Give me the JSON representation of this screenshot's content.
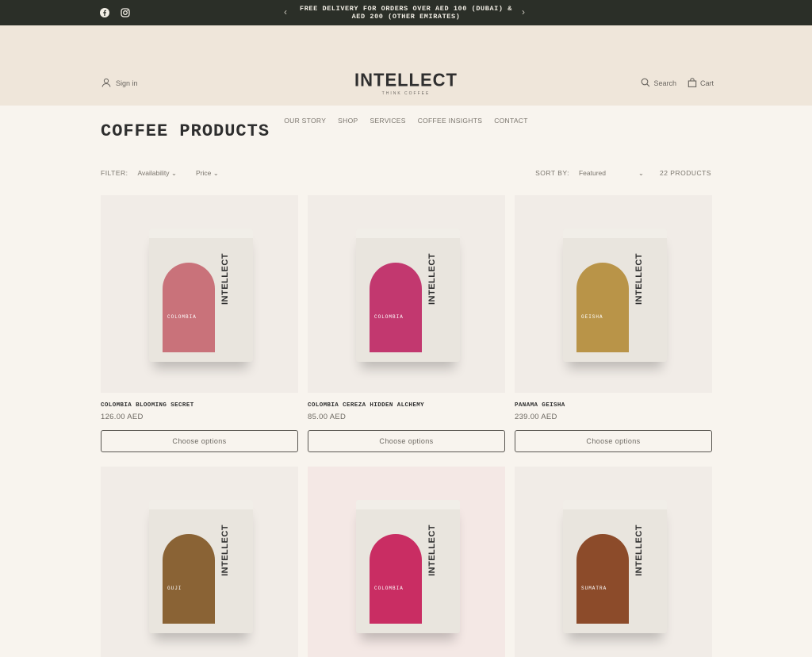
{
  "announcement": {
    "message": "FREE DELIVERY FOR ORDERS OVER AED 100 (DUBAI) & AED 200 (OTHER EMIRATES)",
    "social": [
      "facebook-icon",
      "instagram-icon"
    ]
  },
  "header": {
    "signin_label": "Sign in",
    "logo_text": "INTELLECT",
    "logo_sub": "THINK COFFEE",
    "search_label": "Search",
    "cart_label": "Cart"
  },
  "nav": {
    "items": [
      "OUR STORY",
      "SHOP",
      "SERVICES",
      "COFFEE INSIGHTS",
      "CONTACT"
    ]
  },
  "page": {
    "title": "COFFEE PRODUCTS"
  },
  "filters": {
    "label": "FILTER:",
    "availability": "Availability",
    "price": "Price",
    "sort_label": "SORT BY:",
    "sort_value": "Featured",
    "count": "22 PRODUCTS"
  },
  "products": [
    {
      "name": "COLOMBIA BLOOMING SECRET",
      "price": "126.00 AED",
      "button": "Choose options",
      "origin": "COLOMBIA",
      "brand": "INTELLECT",
      "color": "#c9727a",
      "bg": "plain"
    },
    {
      "name": "COLOMBIA CEREZA HIDDEN ALCHEMY",
      "price": "85.00 AED",
      "button": "Choose options",
      "origin": "COLOMBIA",
      "brand": "INTELLECT",
      "color": "#c2386f",
      "bg": "plain"
    },
    {
      "name": "PANAMA GEISHA",
      "price": "239.00 AED",
      "button": "Choose options",
      "origin": "GEISHA",
      "brand": "INTELLECT",
      "color": "#b99448",
      "bg": "plain"
    },
    {
      "origin": "GUJI",
      "brand": "INTELLECT",
      "color": "#8a6335",
      "bg": "plain"
    },
    {
      "origin": "COLOMBIA",
      "brand": "INTELLECT",
      "color": "#c92d63",
      "bg": "pink"
    },
    {
      "origin": "SUMATRA",
      "brand": "INTELLECT",
      "color": "#8c4b2a",
      "bg": "plain"
    }
  ],
  "colors": {
    "announcement_bg": "#2b2f28",
    "header_bg": "#efe6da",
    "page_bg": "#f8f4ee"
  }
}
